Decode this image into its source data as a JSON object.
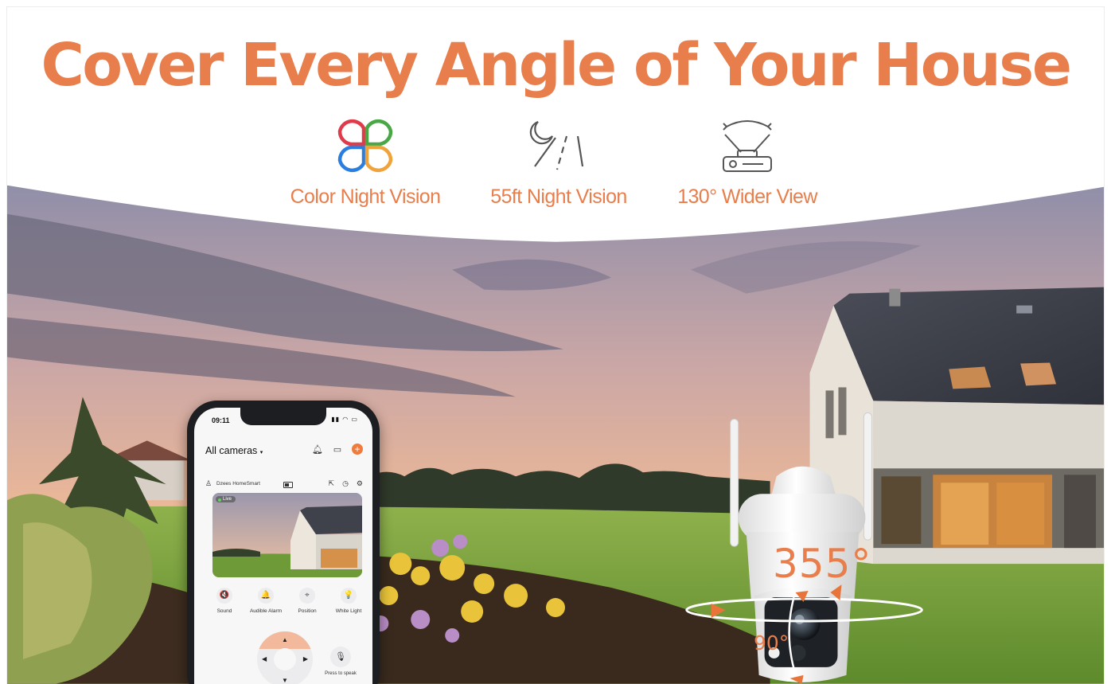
{
  "banner": {
    "headline": "Cover Every Angle of Your House",
    "features": [
      {
        "icon": "color-petals-icon",
        "label": "Color Night Vision"
      },
      {
        "icon": "moon-beam-icon",
        "label": "55ft Night Vision"
      },
      {
        "icon": "wide-angle-camera-icon",
        "label": "130° Wider View"
      }
    ],
    "rotation_label": "355°",
    "tilt_label": "90°",
    "accent_color": "#e77e4b"
  },
  "app": {
    "status_time": "09:11",
    "title": "All cameras",
    "device_name": "Dzees HomeSmart",
    "live_label": "Live",
    "controls": [
      {
        "icon": "sound-mute-icon",
        "glyph": "🔇",
        "label": "Sound"
      },
      {
        "icon": "alarm-icon",
        "glyph": "🔔",
        "label": "Audible Alarm"
      },
      {
        "icon": "position-icon",
        "glyph": "⌖",
        "label": "Position"
      },
      {
        "icon": "light-bulb-icon",
        "glyph": "💡",
        "label": "White Light"
      }
    ],
    "talk_label": "Press to speak",
    "accent_color": "#f07b3c"
  }
}
